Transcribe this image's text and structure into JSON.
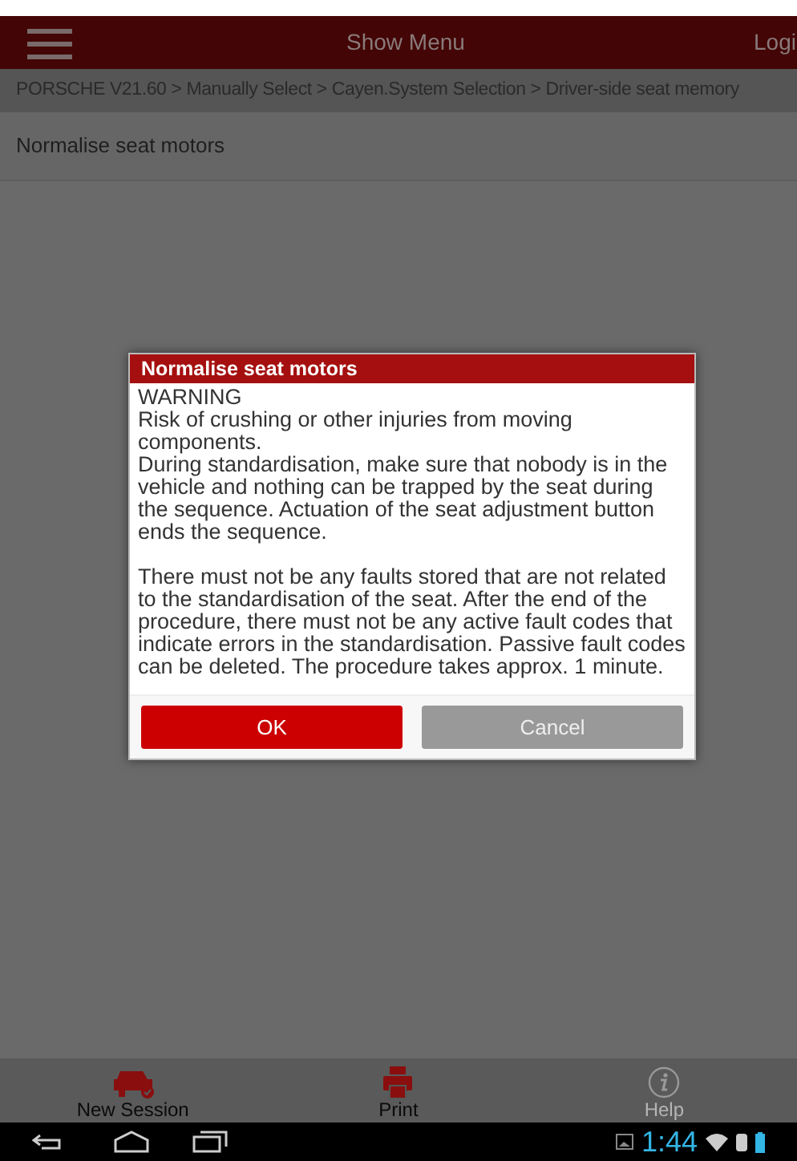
{
  "header": {
    "title": "Show Menu",
    "right_label": "Logi"
  },
  "breadcrumb": "PORSCHE V21.60 > Manually Select > Cayen.System Selection > Driver-side seat memory",
  "page_title": "Normalise seat motors",
  "dialog": {
    "title": "Normalise seat motors",
    "paragraphs": [
      [
        "WARNING",
        "Risk of crushing or other injuries from moving components.",
        "During standardisation, make sure that nobody is in the vehicle and nothing can be trapped by the seat during the sequence. Actuation of the seat adjustment button ends the sequence."
      ],
      [
        "There must not be any faults stored that are not related to the standardisation of the seat.  After the end of the procedure, there must not be any active fault codes that indicate errors in the standardisation. Passive fault codes can be deleted. The procedure takes approx. 1 minute."
      ]
    ],
    "buttons": [
      {
        "label": "OK",
        "kind": "primary"
      },
      {
        "label": "Cancel",
        "kind": "secondary"
      }
    ]
  },
  "bottom_bar": [
    {
      "label": "New Session",
      "kind": "car",
      "disabled": false
    },
    {
      "label": "Print",
      "kind": "print",
      "disabled": false
    },
    {
      "label": "Help",
      "kind": "info",
      "disabled": true
    }
  ],
  "system_bar": {
    "time": "1:44"
  }
}
